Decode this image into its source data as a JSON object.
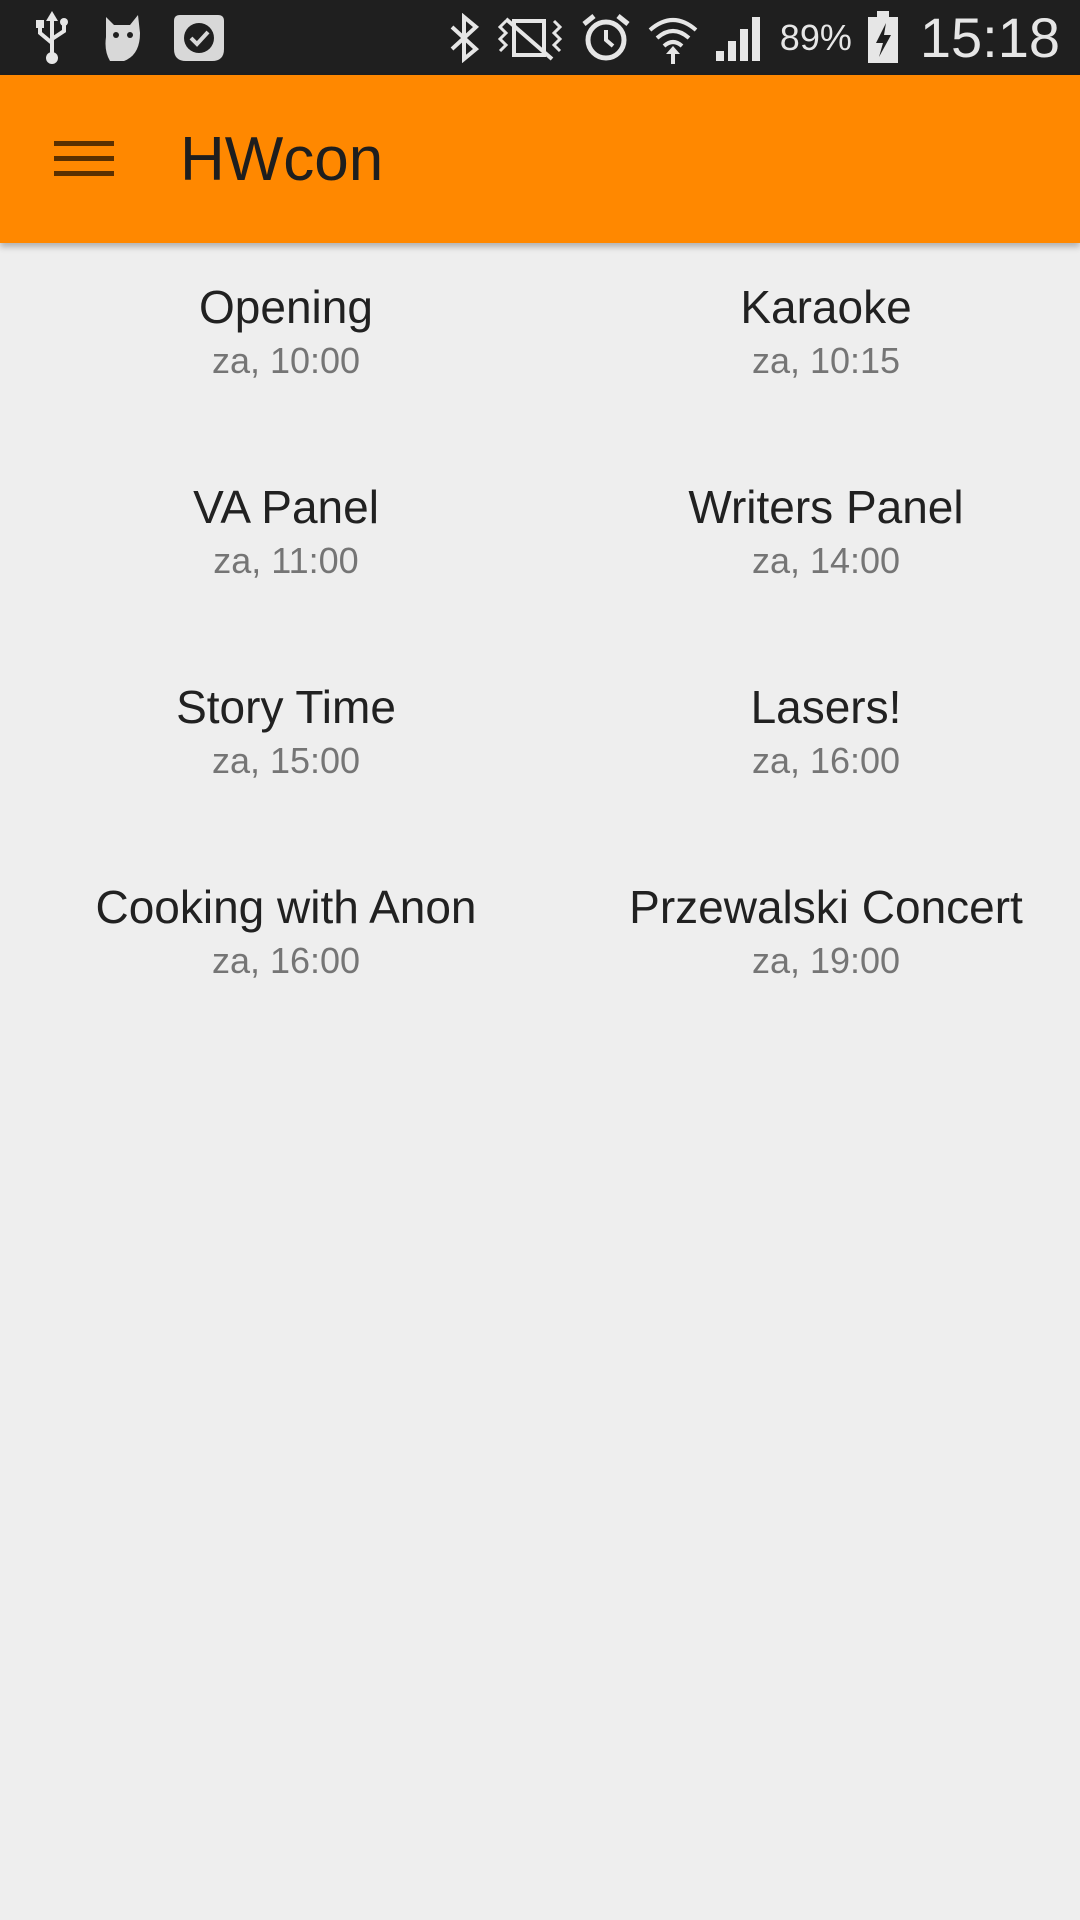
{
  "status_bar": {
    "left_icons": [
      "usb-icon",
      "cat-notification-icon",
      "checkmark-notification-icon"
    ],
    "right_icons": [
      "bluetooth-icon",
      "vibrate-icon",
      "alarm-icon",
      "wifi-icon",
      "signal-icon",
      "battery-charging-icon"
    ],
    "battery_percent": "89%",
    "time": "15:18"
  },
  "app_bar": {
    "title": "HWcon",
    "menu_icon": "hamburger-menu-icon",
    "color": "#ff8800"
  },
  "events": [
    {
      "title": "Opening",
      "time": "za, 10:00"
    },
    {
      "title": "Karaoke",
      "time": "za, 10:15"
    },
    {
      "title": "VA Panel",
      "time": "za, 11:00"
    },
    {
      "title": "Writers Panel",
      "time": "za, 14:00"
    },
    {
      "title": "Story Time",
      "time": "za, 15:00"
    },
    {
      "title": "Lasers!",
      "time": "za, 16:00"
    },
    {
      "title": "Cooking with Anon",
      "time": "za, 16:00"
    },
    {
      "title": "Przewalski Concert",
      "time": "za, 19:00"
    }
  ]
}
